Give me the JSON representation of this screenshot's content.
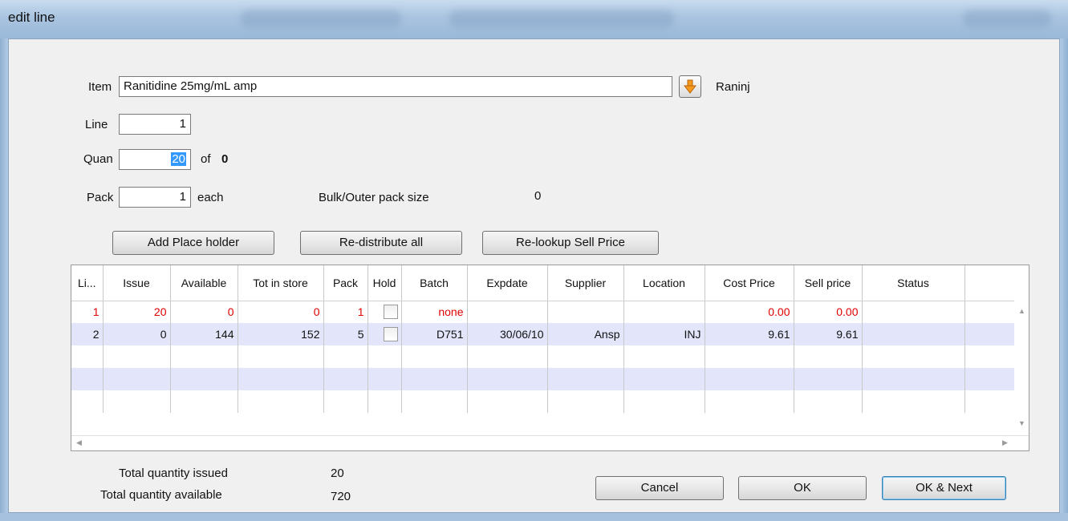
{
  "window": {
    "title": "edit line"
  },
  "form": {
    "item_label": "Item",
    "item_value": "Ranitidine 25mg/mL amp",
    "item_code": "Raninj",
    "line_label": "Line",
    "line_value": "1",
    "quan_label": "Quan",
    "quan_value": "20",
    "quan_of_label": "of",
    "quan_of_value": "0",
    "pack_label": "Pack",
    "pack_value": "1",
    "pack_unit": "each",
    "bulk_label": "Bulk/Outer pack size",
    "bulk_value": "0"
  },
  "buttons": {
    "add_place_holder": "Add Place holder",
    "redistribute_all": "Re-distribute all",
    "relookup_sell_price": "Re-lookup Sell Price",
    "cancel": "Cancel",
    "ok": "OK",
    "ok_next": "OK & Next"
  },
  "grid": {
    "columns": [
      "Li...",
      "Issue",
      "Available",
      "Tot in store",
      "Pack",
      "Hold",
      "Batch",
      "Expdate",
      "Supplier",
      "Location",
      "Cost Price",
      "Sell price",
      "Status"
    ],
    "rows": [
      {
        "line": "1",
        "issue": "20",
        "available": "0",
        "tot_in_store": "0",
        "pack": "1",
        "batch": "none",
        "expdate": "",
        "supplier": "",
        "location": "",
        "cost_price": "0.00",
        "sell_price": "0.00",
        "status": ""
      },
      {
        "line": "2",
        "issue": "0",
        "available": "144",
        "tot_in_store": "152",
        "pack": "5",
        "batch": "D751",
        "expdate": "30/06/10",
        "supplier": "Ansp",
        "location": "INJ",
        "cost_price": "9.61",
        "sell_price": "9.61",
        "status": ""
      }
    ]
  },
  "totals": {
    "issued_label": "Total quantity issued",
    "issued_value": "20",
    "available_label": "Total quantity available",
    "available_value": "720"
  },
  "colors": {
    "warning_red": "#e00000",
    "alt_row": "#e3e6fb",
    "selection": "#3399ff"
  },
  "icons": {
    "item_dropdown": "orange-down-arrow-icon"
  }
}
